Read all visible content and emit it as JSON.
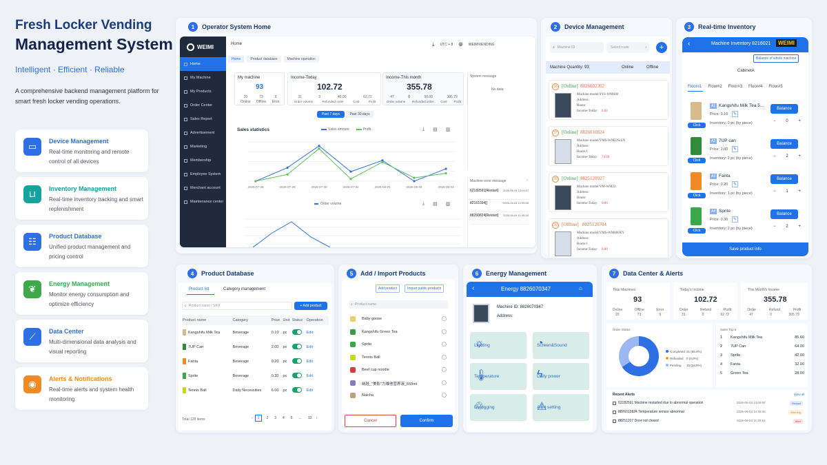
{
  "hero": {
    "title_line1": "Fresh Locker Vending",
    "title_line2": "Management System",
    "tagline": "Intelligent · Efficient · Reliable",
    "description": "A comprehensive backend management platform for smart fresh locker vending operations."
  },
  "features": [
    {
      "title": "Device Management",
      "desc": "Real-time monitoring and remote control of all devices",
      "color": "#2f6fe4",
      "icon": "monitor-icon"
    },
    {
      "title": "Inventory Management",
      "desc": "Real-time inventory tracking and smart replenishment",
      "color": "#16a3a0",
      "icon": "inbox-icon"
    },
    {
      "title": "Product Database",
      "desc": "Unified product management and pricing control",
      "color": "#2f6fe4",
      "icon": "database-icon"
    },
    {
      "title": "Energy Management",
      "desc": "Monitor energy consumption and optimize efficiency",
      "color": "#3fa84a",
      "icon": "leaf-icon"
    },
    {
      "title": "Data Center",
      "desc": "Multi-dimensional data analysis and visual reporting",
      "color": "#2f6fe4",
      "icon": "chart-icon"
    },
    {
      "title": "Alerts & Notifications",
      "desc": "Real-time alerts and system health monitoring",
      "color": "#f08a24",
      "icon": "bell-icon"
    }
  ],
  "sections": {
    "s1": {
      "n": "1",
      "t": "Operator System Home"
    },
    "s2": {
      "n": "2",
      "t": "Device Management"
    },
    "s3": {
      "n": "3",
      "t": "Real-time Inventory"
    },
    "s4": {
      "n": "4",
      "t": "Product Database"
    },
    "s5": {
      "n": "5",
      "t": "Add / Import Products"
    },
    "s6": {
      "n": "6",
      "t": "Energy Management"
    },
    "s7": {
      "n": "7",
      "t": "Data Center & Alerts"
    }
  },
  "home": {
    "logo": "WEIMI",
    "crumb": "Home",
    "utc": "UTC + 8",
    "user": "WEIMIVENDING",
    "tabs": [
      "Home",
      "Product database",
      "Machine operation"
    ],
    "menu": [
      "Home",
      "My Machine",
      "My Products",
      "Order Center",
      "Sales Report",
      "Advertisement",
      "Marketing",
      "Membership",
      "Employee System",
      "Merchant account",
      "Maintenance center"
    ],
    "my_machine": {
      "label": "My machine",
      "total": "93",
      "online": "20",
      "offline": "73",
      "error": "9",
      "l1": "Online",
      "l2": "Offline",
      "l3": "Error"
    },
    "today": {
      "label": "Income-Today",
      "value": "102.72",
      "a": "31",
      "b": "0",
      "c": "40.00",
      "d": "62.72",
      "la": "Order volume",
      "lb": "Refunded order",
      "lc": "Cost",
      "ld": "Profit"
    },
    "month": {
      "label": "Income-This month",
      "value": "355.78",
      "a": "47",
      "b": "0",
      "c": "50.00",
      "d": "305.79",
      "la": "Order volume",
      "lb": "Refunded order",
      "lc": "Cost",
      "ld": "Profit"
    },
    "sys_msg": "System message",
    "no_data": "No data",
    "btn7": "Past 7 days",
    "btn30": "Past 30 days",
    "sales_title": "Sales statistics",
    "leg_sales": "Sales amount",
    "leg_profit": "Profit",
    "err_title": "Machine error message",
    "errors": [
      {
        "id": "62182591[Restart]",
        "d": "2026-06-04 13:09:07"
      },
      {
        "id": "82161034[]",
        "d": "2026-06-04 12:55:06"
      },
      {
        "id": "88260824[Restart]",
        "d": "2026-06-04 11:30:16"
      }
    ],
    "order_vol": "Order volume"
  },
  "chart_data": {
    "type": "line",
    "categories": [
      "2026-07-28",
      "2026-07-29",
      "2026-07-30",
      "2026-07-31",
      "2026-08-01",
      "2026-08-02",
      "2026-08-03"
    ],
    "series": [
      {
        "name": "Sales amount",
        "values": [
          0,
          24,
          63,
          17,
          37,
          0,
          22
        ]
      },
      {
        "name": "Profit",
        "values": [
          0,
          12,
          58,
          4,
          34,
          6,
          14
        ]
      }
    ],
    "legend": "top-center"
  },
  "device": {
    "search": "Machine ID",
    "route": "Select route",
    "qty_label": "Machine Quantity: 93",
    "online": "Online",
    "offline": "Offline",
    "machines": [
      {
        "n": "36",
        "status": "[Online]",
        "id": "8826602302",
        "model": "Machine model:SYS-WM600",
        "addr": "Address:",
        "route": "Route:",
        "inc": "Income-Today:",
        "val": "0.02"
      },
      {
        "n": "37",
        "status": "[Online]",
        "id": "8826010824",
        "model": "Machine model:VMS-WM22S-SN",
        "addr": "Address:",
        "route": "Route:1",
        "inc": "Income-Today:",
        "val": "74.60"
      },
      {
        "n": "38",
        "status": "[Online]",
        "id": "8825120927",
        "model": "Machine model:VM-WM22",
        "addr": "Address:",
        "route": "Route:",
        "inc": "Income-Today:",
        "val": "0.00"
      },
      {
        "n": "39",
        "status": "[Offline]",
        "id": "8825120704",
        "model": "Machine model:VMS-WM860XY",
        "addr": "Address:",
        "route": "Route:1",
        "inc": "Income-Today:",
        "val": "0.00"
      }
    ]
  },
  "inventory": {
    "title": "Machine Inventory 8216021",
    "badge": "WEIMI",
    "balance_all": "Balance of whole machine",
    "cabinet": "CabinetA",
    "floors": [
      "Floor#1",
      "Floor#2",
      "Floor#3",
      "Floor#4",
      "Floor#5"
    ],
    "items": [
      {
        "slot": "A1",
        "name": "Kangshifu Milk Tea 5...",
        "price": "Price: 0.10",
        "inv": "Inventory: 0 pc (by piece)",
        "qty": "0",
        "color": "#d8b98a"
      },
      {
        "slot": "A2",
        "name": "7UP can",
        "price": "Price: 2.00",
        "inv": "Inventory: 2 pc (by piece)",
        "qty": "2",
        "color": "#2f8a3a"
      },
      {
        "slot": "A3",
        "name": "Fanta",
        "price": "Price: 0.20",
        "inv": "Inventory: 1 pc (by piece)",
        "qty": "1",
        "color": "#f08a24"
      },
      {
        "slot": "A4",
        "name": "Sprite",
        "price": "Price: 0.30",
        "inv": "Inventory: 2 pc (by piece)",
        "qty": "2",
        "color": "#3aa84a"
      }
    ],
    "balance": "Balance",
    "click": "Click",
    "save": "Save product info"
  },
  "productdb": {
    "tab1": "Product list",
    "tab2": "Category management",
    "search": "Product name / SKU",
    "add": "+ Add product",
    "cols": [
      "Product name",
      "Category",
      "Price",
      "Unit",
      "Status",
      "Operation"
    ],
    "rows": [
      {
        "name": "Kangshifu Milk Tea",
        "cat": "Beverage",
        "price": "0.10",
        "unit": "pc",
        "color": "#d8b98a"
      },
      {
        "name": "7UP Can",
        "cat": "Beverage",
        "price": "2.00",
        "unit": "pc",
        "color": "#2f8a3a"
      },
      {
        "name": "Fanta",
        "cat": "Beverage",
        "price": "0.20",
        "unit": "pc",
        "color": "#f08a24"
      },
      {
        "name": "Sprite",
        "cat": "Beverage",
        "price": "0.30",
        "unit": "pc",
        "color": "#3aa84a"
      },
      {
        "name": "Tennis Ball",
        "cat": "Daily Necessities",
        "price": "6.00",
        "unit": "pc",
        "color": "#c8d820"
      }
    ],
    "edit": "Edit",
    "total": "Total 128 items",
    "pages": [
      "1",
      "2",
      "3",
      "4",
      "5",
      "...",
      "13"
    ]
  },
  "importp": {
    "add": "Add product",
    "import": "Import public products",
    "search": "Product name",
    "items": [
      "Baby goose",
      "Kangshifu Green Tea",
      "Sprite",
      "Tennis Ball",
      "Beef cup noodle",
      "纳娃_\"美影\"力维他营养液_550ml",
      "Naicha"
    ],
    "cancel": "Cancel",
    "confirm": "Confirm"
  },
  "energy": {
    "title": "Energy 8826070347",
    "mid": "Machine ID: 8826070347",
    "addr": "Address:",
    "tiles": [
      "Lighting",
      "Screen&Sound",
      "Temperature",
      "Daily power",
      "Defogging",
      "Alert setting"
    ]
  },
  "datacenter": {
    "total_label": "Total Machines",
    "total": "93",
    "online": "20",
    "offline": "73",
    "error": "9",
    "l1": "Online",
    "l2": "Offline",
    "l3": "Error",
    "today_label": "Today's Income",
    "today": "102.72",
    "t1": "31",
    "t2": "0",
    "t3": "62.72",
    "tl1": "Order",
    "tl2": "Refund",
    "tl3": "Profit",
    "month_label": "This Month's Income",
    "month": "355.78",
    "m1": "47",
    "m2": "0",
    "m3": "305.79",
    "status_label": "Order Status",
    "status": [
      {
        "label": "Completed",
        "val": "31 (66.0%)",
        "color": "#2f6fe4"
      },
      {
        "label": "Refunded",
        "val": "0 (0.0%)",
        "color": "#f0a030"
      },
      {
        "label": "Pending",
        "val": "16 (34.0%)",
        "color": "#9bb8f0"
      }
    ],
    "top_label": "Sales Top 5",
    "top": [
      {
        "n": "1",
        "name": "Kangshifu Milk Tea",
        "v": "85.60"
      },
      {
        "n": "2",
        "name": "7UP Can",
        "v": "64.00"
      },
      {
        "n": "3",
        "name": "Sprite",
        "v": "42.00"
      },
      {
        "n": "4",
        "name": "Fanta",
        "v": "32.00"
      },
      {
        "n": "5",
        "name": "Green Tea",
        "v": "28.00"
      }
    ],
    "alerts_label": "Recent Alerts",
    "view_all": "View all",
    "alerts": [
      {
        "t": "62182591 Machine restarted due to abnormal operation",
        "d": "2026-06-04 13:09:07",
        "tag": "Restart",
        "c": "#2f6fe4",
        "bg": "#e3ecfc"
      },
      {
        "t": "8826010824 Temperature sensor abnormal",
        "d": "2026-06-04 12:55:06",
        "tag": "Warning",
        "c": "#e08a20",
        "bg": "#fdf0de"
      },
      {
        "t": "88251207 Door not closed",
        "d": "2026-06-04 11:30:16",
        "tag": "Alert",
        "c": "#e04040",
        "bg": "#fde3e3"
      }
    ]
  }
}
